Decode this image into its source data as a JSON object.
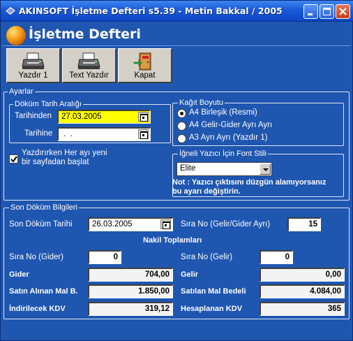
{
  "window": {
    "title": "AKINSOFT İşletme Defteri s5.39 - Metin Bakkal / 2005",
    "controls": [
      "minimize",
      "maximize",
      "close"
    ]
  },
  "header": {
    "title": "İşletme Defteri"
  },
  "toolbar": {
    "print_label": "Yazdır 1",
    "text_print_label": "Text Yazdır",
    "close_label": "Kapat"
  },
  "settings": {
    "group_label": "Ayarlar",
    "date_range": {
      "group_label": "Döküm Tarih Aralığı",
      "from_label": "Tarihinden",
      "from_value": "27.03.2005",
      "to_label": "Tarihine",
      "to_value": " .  ."
    },
    "new_page_checkbox": {
      "label_line1": "Yazdırırken Her ayı yeni",
      "label_line2": "bir sayfadan başlat",
      "checked": true
    },
    "paper_size": {
      "group_label": "Kağıt Boyutu",
      "options": [
        "A4 Birleşik (Resmi)",
        "A4 Gelir-Gider Ayrı Ayrı",
        "A3 Ayrı Ayrı (Yazdır 1)"
      ],
      "selected": "A4 Birleşik (Resmi)"
    },
    "font_style": {
      "group_label": "İğneli Yazıcı İçin Font Stili",
      "selected": "Elite",
      "note_line1": "Not : Yazıcı çıktısını düzgün alamıyorsanız",
      "note_line2": "bu ayarı değiştirin."
    }
  },
  "last_print": {
    "group_label": "Son Döküm Bilgileri",
    "date_label": "Son Döküm Tarihi",
    "date_value": "26.03.2005",
    "seq_separate_label": "Sıra No (Gelir/Gider Ayrı)",
    "seq_separate_value": "15",
    "transfer_totals_label": "Nakil Toplamları",
    "seq_expense_label": "Sıra No (Gider)",
    "seq_expense_value": "0",
    "seq_income_label": "Sıra No (Gelir)",
    "seq_income_value": "0",
    "expense_label": "Gider",
    "expense_value": "704,00",
    "income_label": "Gelir",
    "income_value": "0,00",
    "purchases_label": "Satın Alınan Mal B.",
    "purchases_value": "1.850,00",
    "sales_label": "Satılan Mal Bedeli",
    "sales_value": "4.084,00",
    "deductible_vat_label": "İndirilecek KDV",
    "deductible_vat_value": "319,12",
    "calculated_vat_label": "Hesaplanan KDV",
    "calculated_vat_value": "365"
  },
  "colors": {
    "window_bg": "#1f56b0",
    "title_bar": "#1b5ad8",
    "button_face": "#d4d0c8",
    "highlight_field": "#ffff00"
  }
}
